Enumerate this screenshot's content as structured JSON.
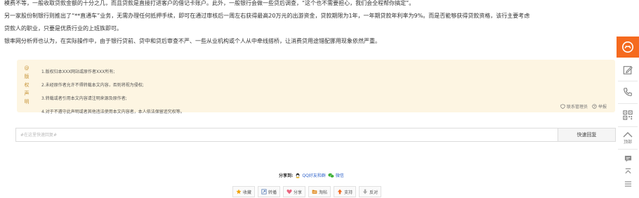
{
  "article": {
    "lines": [
      "模费不等，一般收取贷款金额的十分之几，而且贷款是直接打进客户的借记卡账户。此外，一般银行会做一些贷后调查，“这个也不需要担心，我们会全程帮你搞定”。",
      "另一家股份制银行则推出了“**直通车”业务，无需办理任何抵押手续，即可在通过审核后一周左右获得最高20万元的出游资金，贷款期限为1年，一年期贷款年利率为9%。而是否能够获得贷款资格，该行主要考虑",
      "贷款人的职业，只要是优质行业的上班族即可。",
      "银率网分析师也认为，在实际操作中，由于银行贷前、贷中和贷后审查不严、一些从业机构或个人从中牵线搭桥，让消费贷用途错配挪用现象依然严重。"
    ]
  },
  "notice": {
    "side_chars": [
      "@",
      "版",
      "权",
      "声",
      "明"
    ],
    "items": [
      "1.版权归本XXX网站或原作者XXX所有;",
      "2.未经原作者允许不得转载本文内容，否则将视为侵权;",
      "3.转载或者引用本文内容请注明来源及原作者;",
      "4.对于不遵守此声明或者其他违法使用本文内容者，本人依法保留追究权等。"
    ],
    "contact_label": "联系管理员",
    "report_label": "举报"
  },
  "reply": {
    "placeholder": "#在这里快速回复#",
    "value": "",
    "button_label": "快速回复"
  },
  "share": {
    "label": "分享到:",
    "qq_label": "QQ好友和群",
    "wechat_label": "微信"
  },
  "actions": [
    {
      "label": "收藏",
      "icon": "star-icon",
      "color": "#f0a30a"
    },
    {
      "label": "转播",
      "icon": "forward-icon",
      "color": "#5a7fb8"
    },
    {
      "label": "分享",
      "icon": "heart-icon",
      "color": "#e9667f"
    },
    {
      "label": "淘帖",
      "icon": "folder-icon",
      "color": "#e08a1e"
    },
    {
      "label": "支持",
      "icon": "thumb-up-icon",
      "color": "#f06a1e"
    },
    {
      "label": "反对",
      "icon": "thumb-down-icon",
      "color": "#999999"
    }
  ],
  "sidebar": {
    "top_label": "顶部"
  },
  "colors": {
    "accent": "#f56a1e",
    "notice_bg": "#fdf5e2",
    "notice_text": "#c8963c"
  }
}
